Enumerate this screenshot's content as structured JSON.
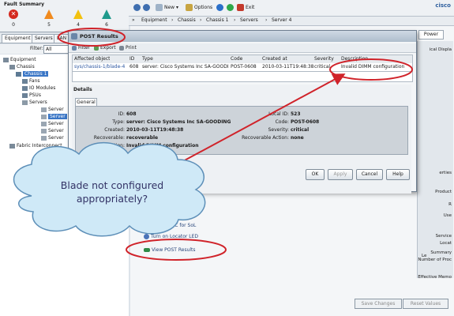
{
  "fault_summary": {
    "title": "Fault Summary",
    "items": [
      {
        "icon": "critical-x-icon",
        "count": "0"
      },
      {
        "icon": "major-triangle-icon",
        "count": "5"
      },
      {
        "icon": "minor-triangle-icon",
        "count": "4"
      },
      {
        "icon": "warning-triangle-icon",
        "count": "6"
      }
    ]
  },
  "toolbar": {
    "new_label": "New",
    "options_label": "Options",
    "exit_label": "Exit",
    "brand": "cisco"
  },
  "breadcrumb": {
    "items": [
      "Equipment",
      "Chassis",
      "Chassis 1",
      "Servers",
      "Server 4"
    ]
  },
  "nav": {
    "tabs": [
      "Equipment",
      "Servers",
      "LAN"
    ],
    "filter_label": "Filter:",
    "filter_value": "All",
    "tree": {
      "root": "Equipment",
      "chassis": "Chassis",
      "chassis1": "Chassis 1",
      "fans": "Fans",
      "io": "IO Modules",
      "psus": "PSUs",
      "servers": "Servers",
      "server_items": [
        "Server",
        "Server",
        "Server",
        "Server",
        "Server"
      ],
      "fabric": "Fabric Interconnect"
    }
  },
  "workspace": {
    "power_tab": "Power",
    "right_labels": [
      "ical Displa",
      "erties",
      "Product",
      "R",
      "Use",
      "Service",
      "Locat",
      "Summary",
      "Number of Proc",
      "Effective Memo",
      "Le"
    ],
    "actions": {
      "ssh": "SSH to BMC for SoL",
      "locator": "Turn on Locator LED",
      "post": "View POST Results"
    },
    "save_changes": "Save Changes",
    "reset_values": "Reset Values"
  },
  "dialog": {
    "title": "POST Results",
    "filter_label": "Filter",
    "export_label": "Export",
    "print_label": "Print",
    "columns": [
      "Affected object",
      "ID",
      "Type",
      "Code",
      "Created at",
      "Severity",
      "Description"
    ],
    "row": {
      "affected_object": "sys/chassis-1/blade-4",
      "id": "608",
      "type": "server: Cisco Systems Inc SA-GOODING",
      "code": "POST-0608",
      "created_at": "2010-03-11T19:48:38",
      "severity": "critical",
      "description": "Invalid DIMM configuration"
    },
    "details_title": "Details",
    "general_tab": "General",
    "details": {
      "id_label": "ID:",
      "id_value": "608",
      "type_label": "Type:",
      "type_value": "server: Cisco Systems Inc SA-GOODING",
      "created_label": "Created:",
      "created_value": "2010-03-11T19:48:38",
      "recoverable_label": "Recoverable:",
      "recoverable_value": "recoverable",
      "description_label": "Description:",
      "description_value": "Invalid DIMM configuration",
      "local_id_label": "Local ID:",
      "local_id_value": "523",
      "code_label": "Code:",
      "code_value": "POST-0608",
      "severity_label": "Severity:",
      "severity_value": "critical",
      "recoverable_action_label": "Recoverable Action:",
      "recoverable_action_value": "none"
    },
    "buttons": {
      "ok": "OK",
      "apply": "Apply",
      "cancel": "Cancel",
      "help": "Help"
    }
  },
  "callout": {
    "line1": "Blade not configured",
    "line2": "appropriately?"
  },
  "colors": {
    "annotation_red": "#d0232a",
    "cloud_fill": "#cfe9f7",
    "cloud_stroke": "#5d8fb8",
    "selection": "#3a76c6"
  }
}
